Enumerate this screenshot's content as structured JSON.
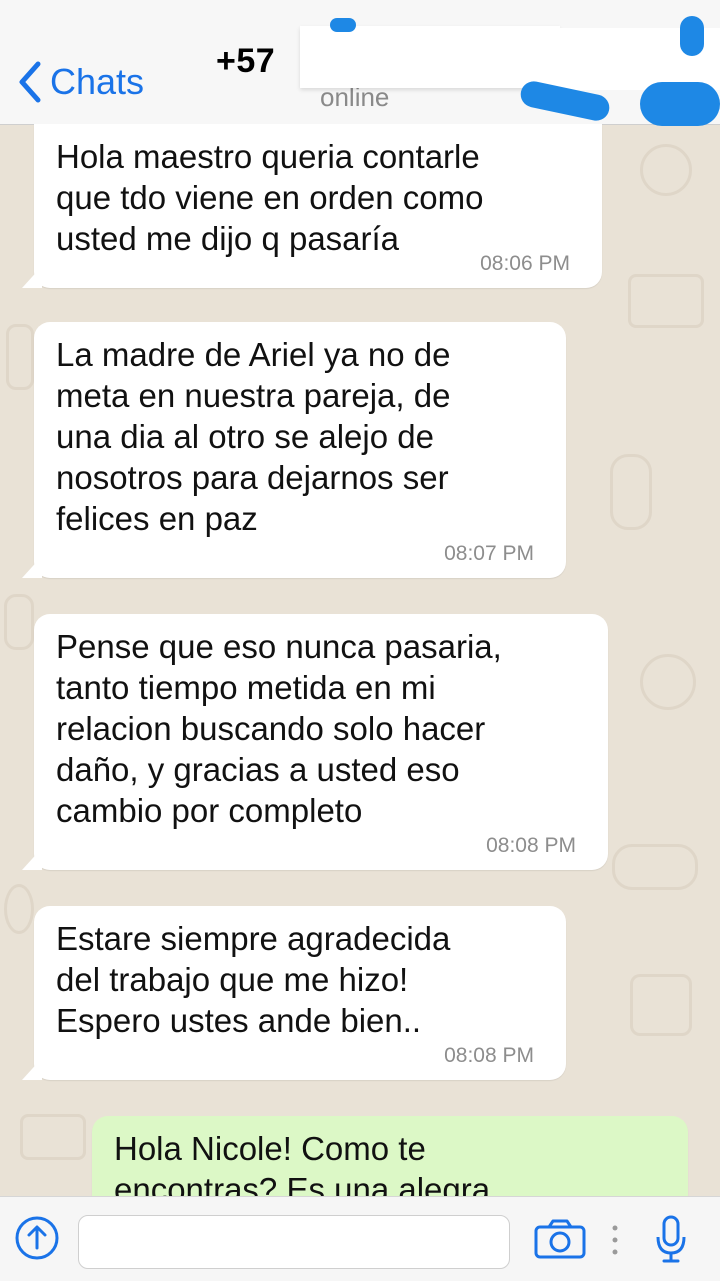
{
  "header": {
    "back_label": "Chats",
    "contact_prefix": "+57",
    "status": "online"
  },
  "messages": [
    {
      "text": "Hola maestro queria contarle\nque tdo viene en orden como\nusted me dijo q pasaría",
      "time": "08:06 PM",
      "direction": "incoming"
    },
    {
      "text": "La madre de Ariel ya no de\nmeta en nuestra pareja, de\nuna dia al otro se alejo de\nnosotros para dejarnos ser\nfelices en paz",
      "time": "08:07 PM",
      "direction": "incoming"
    },
    {
      "text": "Pense que eso nunca pasaria,\ntanto tiempo metida en mi\nrelacion buscando solo hacer\ndaño, y gracias a usted eso\ncambio por completo",
      "time": "08:08 PM",
      "direction": "incoming"
    },
    {
      "text": "Estare siempre agradecida\ndel trabajo que me hizo!\nEspero ustes ande bien..",
      "time": "08:08 PM",
      "direction": "incoming"
    },
    {
      "text": "Hola Nicole! Como te\nencontras? Es una alegra",
      "direction": "outgoing"
    }
  ],
  "composer": {
    "placeholder": ""
  },
  "icons": [
    "chevron-left-icon",
    "share-upload-icon",
    "camera-icon",
    "more-dots-icon",
    "microphone-icon"
  ],
  "colors": {
    "accent": "#1a73e8",
    "outgoing_bubble": "#dcf8c6",
    "incoming_bubble": "#ffffff"
  }
}
